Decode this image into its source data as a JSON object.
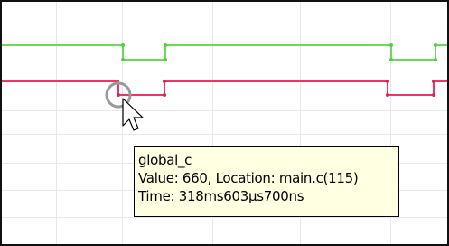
{
  "colors": {
    "grid": "#e8e8e8",
    "signal_1": "#66dd55",
    "signal_2": "#ee3366",
    "cursor_ring": "#999999",
    "tooltip_background": "#ffffe1"
  },
  "tooltip": {
    "variable": "global_c",
    "value_line": "Value: 660, Location: main.c(115)",
    "time_line": "Time: 318ms603μs700ns"
  },
  "cursor": {
    "icon": "arrow-pointer-icon"
  }
}
